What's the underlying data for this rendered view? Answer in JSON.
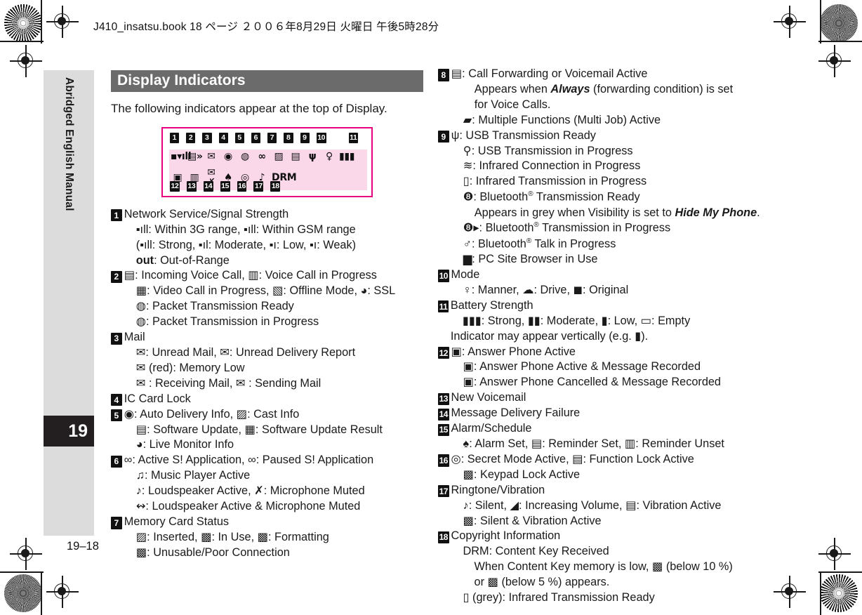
{
  "slug": "J410_insatsu.book  18 ページ  ２００６年8月29日   火曜日   午後5時28分",
  "sidebar": {
    "label": "Abridged English Manual",
    "chapter": "19",
    "folio": "19–18"
  },
  "section": {
    "title": "Display Indicators",
    "intro": "The following indicators appear at the top of Display."
  },
  "figure": {
    "top_numbers": [
      "1",
      "2",
      "3",
      "4",
      "5",
      "6",
      "7",
      "8",
      "9",
      "10",
      "11"
    ],
    "bottom_numbers": [
      "12",
      "13",
      "14",
      "15",
      "16",
      "17",
      "18"
    ],
    "row1_icons": [
      "▪▾ıll",
      "▤»",
      "✉",
      "◉",
      "◍",
      "∞",
      "▨",
      "▤",
      "ψ",
      "♀",
      "▮▮▮"
    ],
    "row2_icons": [
      "▣",
      "▥",
      "✉✗",
      "♠",
      "◎",
      "♪",
      "DRM"
    ]
  },
  "left_column": [
    {
      "num": "1",
      "lines": [
        {
          "indent": 0,
          "text": "Network Service/Signal Strength"
        },
        {
          "indent": 1,
          "text": "▪ıll: Within 3G range, ▪ıll: Within GSM range"
        },
        {
          "indent": 1,
          "text": "(▪ıll: Strong, ▪ıl: Moderate, ▪ı: Low, ▪ı: Weak)"
        },
        {
          "indent": 1,
          "text": "out: Out-of-Range",
          "bold_prefix": "out"
        }
      ]
    },
    {
      "num": "2",
      "lines": [
        {
          "indent": 0,
          "text": "▤: Incoming Voice Call, ▥: Voice Call in Progress"
        },
        {
          "indent": 1,
          "text": "▦: Video Call in Progress,  ▧: Offline Mode, ◕: SSL"
        },
        {
          "indent": 1,
          "text": "◍: Packet Transmission Ready"
        },
        {
          "indent": 1,
          "text": "◍: Packet Transmission in Progress"
        }
      ]
    },
    {
      "num": "3",
      "lines": [
        {
          "indent": 0,
          "text": "Mail"
        },
        {
          "indent": 1,
          "text": "✉: Unread Mail, ✉: Unread Delivery Report"
        },
        {
          "indent": 1,
          "text": "✉ (red): Memory Low"
        },
        {
          "indent": 1,
          "text": "✉ : Receiving Mail, ✉ : Sending Mail"
        }
      ]
    },
    {
      "num": "4",
      "lines": [
        {
          "indent": 0,
          "text": "IC Card Lock"
        }
      ]
    },
    {
      "num": "5",
      "lines": [
        {
          "indent": 0,
          "text": "◉: Auto Delivery Info, ▨: Cast Info"
        },
        {
          "indent": 1,
          "text": "▤: Software Update, ▦: Software Update Result"
        },
        {
          "indent": 1,
          "text": "◕: Live Monitor Info"
        }
      ]
    },
    {
      "num": "6",
      "lines": [
        {
          "indent": 0,
          "text": "∞: Active S! Application, ∞: Paused S! Application"
        },
        {
          "indent": 1,
          "text": "♫: Music Player Active"
        },
        {
          "indent": 1,
          "text": "♪: Loudspeaker Active, ✗: Microphone Muted"
        },
        {
          "indent": 1,
          "text": "↭: Loudspeaker Active & Microphone Muted"
        }
      ]
    },
    {
      "num": "7",
      "lines": [
        {
          "indent": 0,
          "text": "Memory Card Status"
        },
        {
          "indent": 1,
          "text": "▨: Inserted, ▩: In Use, ▩: Formatting"
        },
        {
          "indent": 1,
          "text": "▩: Unusable/Poor Connection"
        }
      ]
    }
  ],
  "right_column": [
    {
      "num": "8",
      "lines": [
        {
          "indent": 0,
          "text": "▤: Call Forwarding or Voicemail Active"
        },
        {
          "indent": 2,
          "html": "Appears when <span class=\"italic\">Always</span> (forwarding condition) is set"
        },
        {
          "indent": 2,
          "text": "for Voice Calls."
        },
        {
          "indent": 1,
          "text": "▰: Multiple Functions (Multi Job) Active"
        }
      ]
    },
    {
      "num": "9",
      "lines": [
        {
          "indent": 0,
          "text": "ψ: USB Transmission Ready"
        },
        {
          "indent": 1,
          "text": "⚲: USB Transmission in Progress"
        },
        {
          "indent": 1,
          "text": "≋: Infrared Connection in Progress"
        },
        {
          "indent": 1,
          "text": "▯: Infrared Transmission in Progress"
        },
        {
          "indent": 1,
          "html": "❽: Bluetooth<sup>®</sup> Transmission Ready"
        },
        {
          "indent": 2,
          "html": "Appears in grey when Visibility is set to <span class=\"italic\">Hide My Phone</span>."
        },
        {
          "indent": 1,
          "html": "❽▸: Bluetooth<sup>®</sup> Transmission in Progress"
        },
        {
          "indent": 1,
          "html": "♂: Bluetooth<sup>®</sup> Talk in Progress"
        },
        {
          "indent": 1,
          "text": "▆: PC Site Browser in Use"
        }
      ]
    },
    {
      "num": "10",
      "lines": [
        {
          "indent": 0,
          "text": "Mode"
        },
        {
          "indent": 1,
          "text": "♀: Manner, ☁: Drive, ◼: Original"
        }
      ]
    },
    {
      "num": "11",
      "lines": [
        {
          "indent": 0,
          "text": "Battery Strength"
        },
        {
          "indent": 1,
          "text": "▮▮▮: Strong, ▮▮: Moderate, ▮: Low, ▭: Empty"
        },
        {
          "indent": 0,
          "text": "Indicator may appear vertically (e.g. ▮).",
          "noindentflush": true
        }
      ]
    },
    {
      "num": "12",
      "lines": [
        {
          "indent": 0,
          "text": "▣: Answer Phone Active"
        },
        {
          "indent": 1,
          "text": "▣: Answer Phone Active & Message Recorded"
        },
        {
          "indent": 1,
          "text": "▣: Answer Phone Cancelled & Message Recorded"
        }
      ]
    },
    {
      "num": "13",
      "lines": [
        {
          "indent": 0,
          "text": "New Voicemail"
        }
      ]
    },
    {
      "num": "14",
      "lines": [
        {
          "indent": 0,
          "text": "Message Delivery Failure"
        }
      ]
    },
    {
      "num": "15",
      "lines": [
        {
          "indent": 0,
          "text": "Alarm/Schedule"
        },
        {
          "indent": 1,
          "text": "♠: Alarm Set, ▤: Reminder Set, ▥: Reminder Unset"
        }
      ]
    },
    {
      "num": "16",
      "lines": [
        {
          "indent": 0,
          "text": "◎: Secret Mode Active, ▤: Function Lock Active"
        },
        {
          "indent": 1,
          "text": "▩: Keypad Lock Active"
        }
      ]
    },
    {
      "num": "17",
      "lines": [
        {
          "indent": 0,
          "text": "Ringtone/Vibration"
        },
        {
          "indent": 1,
          "text": "♪: Silent, ◢: Increasing Volume, ▤: Vibration Active"
        },
        {
          "indent": 1,
          "text": "▩: Silent & Vibration Active"
        }
      ]
    },
    {
      "num": "18",
      "lines": [
        {
          "indent": 0,
          "text": "Copyright Information"
        },
        {
          "indent": 1,
          "text": "DRM: Content Key Received"
        },
        {
          "indent": 2,
          "text": "When Content Key memory is low, ▩ (below 10 %)"
        },
        {
          "indent": 2,
          "text": "or ▩ (below 5 %) appears."
        },
        {
          "indent": 1,
          "text": "▯ (grey): Infrared Transmission Ready"
        }
      ]
    }
  ],
  "colors": {
    "accent_magenta": "#e6007e",
    "band_pink": "#fbd7ea",
    "header_gray": "#6b6b6b",
    "sidebar_gray": "#dcdcdc",
    "chapter_black": "#231f20"
  }
}
